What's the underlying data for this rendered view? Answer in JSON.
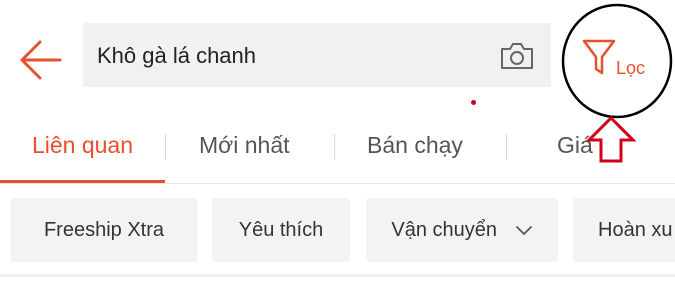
{
  "search": {
    "query": "Khô gà lá chanh"
  },
  "filter": {
    "label": "Lọc"
  },
  "tabs": [
    {
      "label": "Liên quan",
      "active": true
    },
    {
      "label": "Mới nhất",
      "active": false
    },
    {
      "label": "Bán chạy",
      "active": false
    },
    {
      "label": "Giá",
      "active": false
    }
  ],
  "chips": [
    {
      "label": "Freeship Xtra"
    },
    {
      "label": "Yêu thích"
    },
    {
      "label": "Vận chuyển",
      "icon": "chevron-down-icon"
    },
    {
      "label": "Hoàn xu"
    }
  ],
  "icons": {
    "back": "arrow-left-icon",
    "camera": "camera-icon",
    "filter": "funnel-icon"
  },
  "colors": {
    "accent": "#e6502d",
    "annotation": "#d0021b"
  }
}
